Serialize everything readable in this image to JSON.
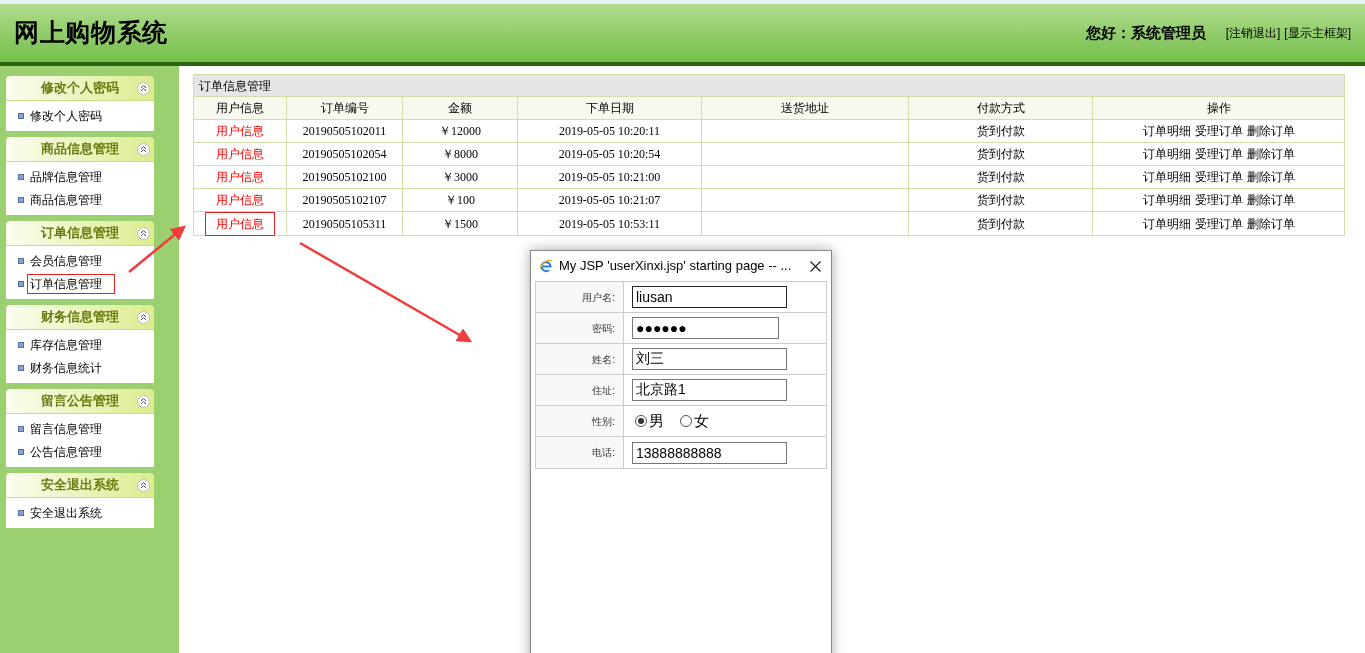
{
  "header": {
    "title": "网上购物系统",
    "greeting": "您好：系统管理员",
    "links": [
      "[注销退出]",
      "[显示主框架]"
    ]
  },
  "sidebar": {
    "groups": [
      {
        "title": "修改个人密码",
        "items": [
          {
            "label": "修改个人密码",
            "highlighted": false
          }
        ]
      },
      {
        "title": "商品信息管理",
        "items": [
          {
            "label": "品牌信息管理",
            "highlighted": false
          },
          {
            "label": "商品信息管理",
            "highlighted": false
          }
        ]
      },
      {
        "title": "订单信息管理",
        "items": [
          {
            "label": "会员信息管理",
            "highlighted": false
          },
          {
            "label": "订单信息管理",
            "highlighted": true
          }
        ]
      },
      {
        "title": "财务信息管理",
        "items": [
          {
            "label": "库存信息管理",
            "highlighted": false
          },
          {
            "label": "财务信息统计",
            "highlighted": false
          }
        ]
      },
      {
        "title": "留言公告管理",
        "items": [
          {
            "label": "留言信息管理",
            "highlighted": false
          },
          {
            "label": "公告信息管理",
            "highlighted": false
          }
        ]
      },
      {
        "title": "安全退出系统",
        "items": [
          {
            "label": "安全退出系统",
            "highlighted": false
          }
        ]
      }
    ]
  },
  "table": {
    "title": "订单信息管理",
    "columns": [
      "用户信息",
      "订单编号",
      "金额",
      "下单日期",
      "送货地址",
      "付款方式",
      "操作"
    ],
    "rows": [
      {
        "user_link": "用户信息",
        "highlighted": false,
        "order_no": "20190505102011",
        "amount": "￥12000",
        "date": "2019-05-05 10:20:11",
        "address": "",
        "payment": "货到付款",
        "actions": [
          "订单明细",
          "受理订单",
          "删除订单"
        ]
      },
      {
        "user_link": "用户信息",
        "highlighted": false,
        "order_no": "20190505102054",
        "amount": "￥8000",
        "date": "2019-05-05 10:20:54",
        "address": "",
        "payment": "货到付款",
        "actions": [
          "订单明细",
          "受理订单",
          "删除订单"
        ]
      },
      {
        "user_link": "用户信息",
        "highlighted": false,
        "order_no": "20190505102100",
        "amount": "￥3000",
        "date": "2019-05-05 10:21:00",
        "address": "",
        "payment": "货到付款",
        "actions": [
          "订单明细",
          "受理订单",
          "删除订单"
        ]
      },
      {
        "user_link": "用户信息",
        "highlighted": false,
        "order_no": "20190505102107",
        "amount": "￥100",
        "date": "2019-05-05 10:21:07",
        "address": "",
        "payment": "货到付款",
        "actions": [
          "订单明细",
          "受理订单",
          "删除订单"
        ]
      },
      {
        "user_link": "用户信息",
        "highlighted": true,
        "order_no": "20190505105311",
        "amount": "￥1500",
        "date": "2019-05-05 10:53:11",
        "address": "",
        "payment": "货到付款",
        "actions": [
          "订单明细",
          "受理订单",
          "删除订单"
        ]
      }
    ]
  },
  "popup": {
    "title": "My JSP 'userXinxi.jsp' starting page -- ...",
    "fields": [
      {
        "kind": "text",
        "label": "用户名:",
        "value": "liusan"
      },
      {
        "kind": "text",
        "label": "密码:",
        "value": "●●●●●●"
      },
      {
        "kind": "text",
        "label": "姓名:",
        "value": "刘三"
      },
      {
        "kind": "text",
        "label": "住址:",
        "value": "北京路1"
      },
      {
        "kind": "radio",
        "label": "性别:",
        "options": [
          {
            "label": "男",
            "selected": true
          },
          {
            "label": "女",
            "selected": false
          }
        ]
      },
      {
        "kind": "text",
        "label": "电话:",
        "value": "13888888888"
      }
    ]
  }
}
